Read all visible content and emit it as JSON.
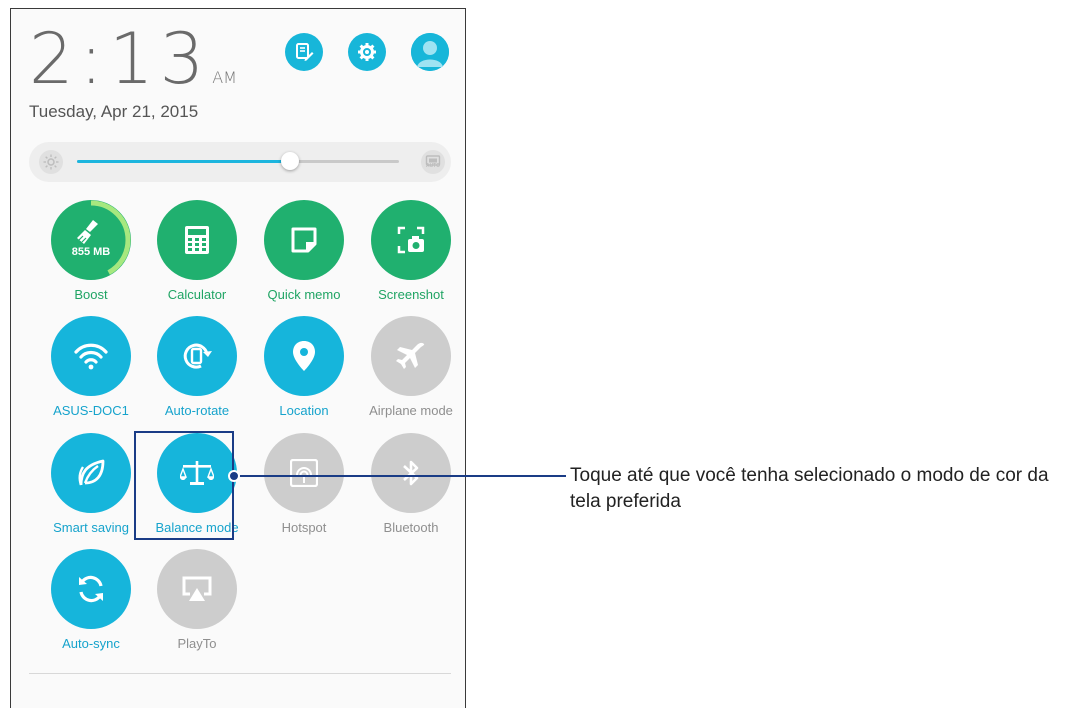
{
  "status": {
    "time": "2:13",
    "ampm": "AM",
    "date": "Tuesday, Apr 21, 2015"
  },
  "header_icons": [
    {
      "name": "edit-notes-icon"
    },
    {
      "name": "settings-icon"
    },
    {
      "name": "user-avatar-icon"
    }
  ],
  "brightness": {
    "level": 0.66,
    "auto_label": "AUTO"
  },
  "tiles": [
    {
      "label": "Boost",
      "value": "855 MB",
      "state": "green",
      "icon": "broom-icon",
      "boost_fraction": 0.42
    },
    {
      "label": "Calculator",
      "state": "green",
      "icon": "calculator-icon"
    },
    {
      "label": "Quick memo",
      "state": "green",
      "icon": "note-icon"
    },
    {
      "label": "Screenshot",
      "state": "green",
      "icon": "screenshot-icon"
    },
    {
      "label": "ASUS-DOC1",
      "state": "on",
      "icon": "wifi-icon"
    },
    {
      "label": "Auto-rotate",
      "state": "on",
      "icon": "rotate-icon"
    },
    {
      "label": "Location",
      "state": "on",
      "icon": "location-pin-icon"
    },
    {
      "label": "Airplane mode",
      "state": "off",
      "icon": "airplane-icon"
    },
    {
      "label": "Smart saving",
      "state": "on",
      "icon": "leaf-icon"
    },
    {
      "label": "Balance mode",
      "state": "on",
      "icon": "balance-scale-icon"
    },
    {
      "label": "Hotspot",
      "state": "off",
      "icon": "hotspot-icon"
    },
    {
      "label": "Bluetooth",
      "state": "off",
      "icon": "bluetooth-icon"
    },
    {
      "label": "Auto-sync",
      "state": "on",
      "icon": "sync-icon"
    },
    {
      "label": "PlayTo",
      "state": "off",
      "icon": "cast-icon"
    }
  ],
  "callout": {
    "text": "Toque até que você tenha selecionado o modo de cor da tela preferida"
  },
  "colors": {
    "green": "#20b06f",
    "blue": "#16b5db",
    "gray": "#cdcdcd",
    "callout": "#1a3c86"
  }
}
